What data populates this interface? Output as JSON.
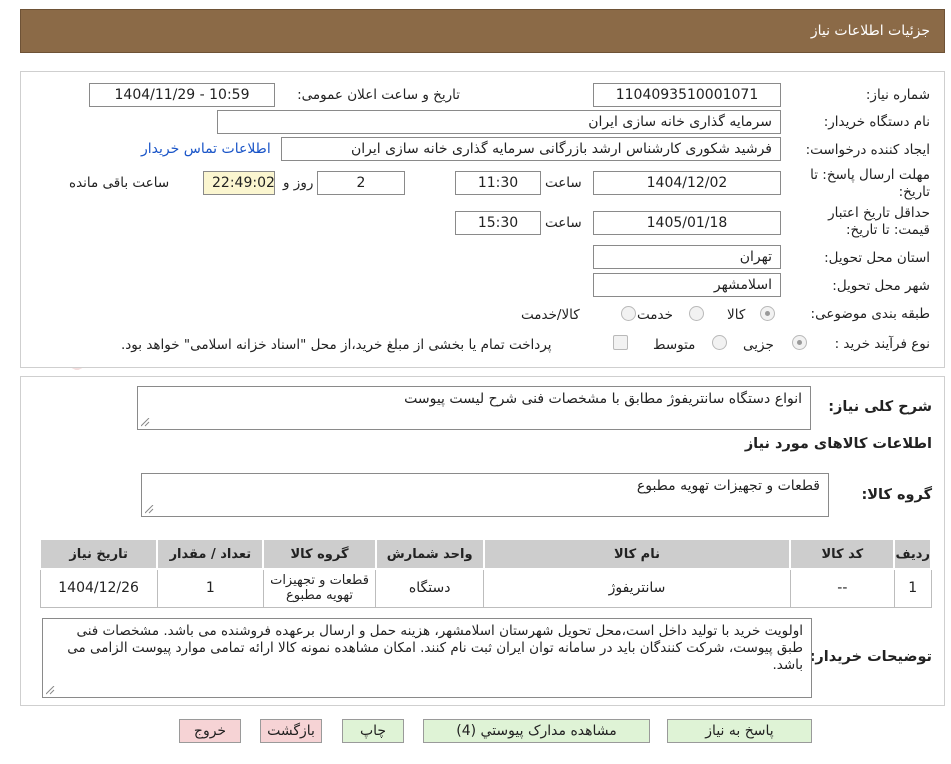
{
  "header": {
    "title": "جزئیات اطلاعات نیاز"
  },
  "form": {
    "need_number_label": "شماره نیاز:",
    "need_number": "1104093510001071",
    "announce_label": "تاریخ و ساعت اعلان عمومی:",
    "announce_value": "1404/11/29 - 10:59",
    "buyer_org_label": "نام دستگاه خریدار:",
    "buyer_org": "سرمایه گذاری خانه سازی ایران",
    "creator_label": "ایجاد کننده درخواست:",
    "creator": "فرشید شکوری کارشناس ارشد بازرگانی سرمایه گذاری خانه سازی ایران",
    "contact_link": "اطلاعات تماس خریدار",
    "deadline_label_1": "مهلت ارسال پاسخ: تا",
    "deadline_label_2": "تاریخ:",
    "deadline_date": "1404/12/02",
    "time_label": "ساعت",
    "deadline_time": "11:30",
    "days_value": "2",
    "day_and_label": "روز و",
    "remaining_time": "22:49:02",
    "remaining_label": "ساعت باقی مانده",
    "validity_label_1": "حداقل تاریخ اعتبار",
    "validity_label_2": "قیمت: تا تاریخ:",
    "validity_date": "1405/01/18",
    "validity_time": "15:30",
    "province_label": "استان محل تحویل:",
    "province": "تهران",
    "city_label": "شهر محل تحویل:",
    "city": "اسلامشهر",
    "category_label": "طبقه بندی موضوعی:",
    "category_options": [
      "کالا",
      "خدمت",
      "کالا/خدمت"
    ],
    "process_label": "نوع فرآیند خرید :",
    "process_options": [
      "جزیی",
      "متوسط"
    ],
    "treasury_note": "پرداخت تمام یا بخشی از مبلغ خرید،از محل \"اسناد خزانه اسلامی\" خواهد بود."
  },
  "summary": {
    "label": "شرح کلی نیاز:",
    "text": "انواع دستگاه سانتریفوژ مطابق با مشخصات فنی شرح لیست پیوست"
  },
  "items_section": {
    "title": "اطلاعات کالاهای مورد نیاز",
    "group_label": "گروه کالا:",
    "group_value": "قطعات و تجهیزات تهویه مطبوع"
  },
  "table": {
    "headers": [
      "ردیف",
      "کد کالا",
      "نام کالا",
      "واحد شمارش",
      "گروه کالا",
      "تعداد / مقدار",
      "تاریخ نیاز"
    ],
    "rows": [
      [
        "1",
        "--",
        "سانتریفوژ",
        "دستگاه",
        "قطعات و تجهیزات تهویه مطبوع",
        "1",
        "1404/12/26"
      ]
    ]
  },
  "buyer_notes": {
    "label": "توضیحات خریدار:",
    "text": "اولویت خرید با تولید داخل است،محل تحویل شهرستان اسلامشهر، هزینه حمل و ارسال برعهده فروشنده می باشد. مشخصات فنی طبق پیوست، شرکت کنندگان باید در سامانه توان ایران ثبت نام کنند. امکان مشاهده نمونه کالا ارائه تمامی موارد پیوست الزامی می باشد."
  },
  "buttons": {
    "reply": "پاسخ به نیاز",
    "attachments": "مشاهده مدارک پیوستي (4)",
    "print": "چاپ",
    "back": "بازگشت",
    "exit": "خروج"
  },
  "watermark": {
    "text": "AriaTender.neT"
  },
  "colors": {
    "header": "#8b6a47",
    "link": "#1a55c8",
    "green_button": "#dff3d6",
    "red_button": "#f6d3d5",
    "remaining_bg": "#fbf6d0"
  }
}
